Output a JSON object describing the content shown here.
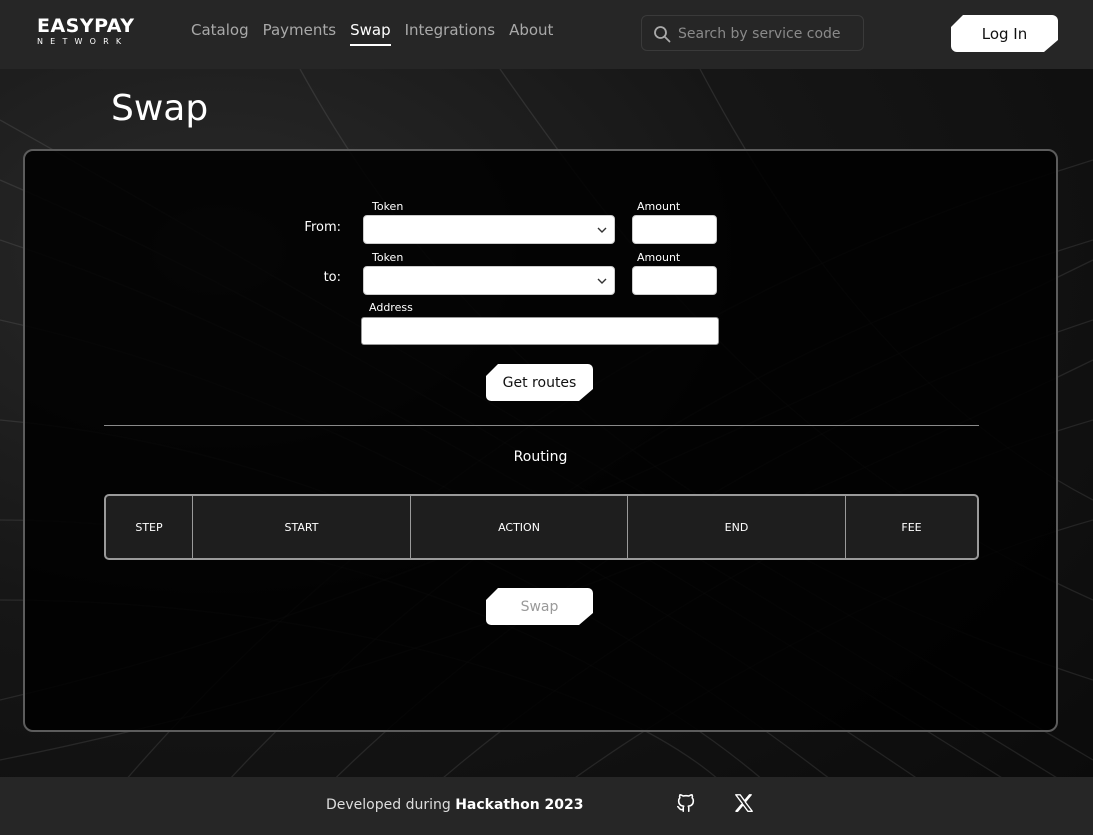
{
  "header": {
    "logo_main": "EASYPAY",
    "logo_sub": "NETWORK",
    "nav": [
      {
        "label": "Catalog"
      },
      {
        "label": "Payments"
      },
      {
        "label": "Swap"
      },
      {
        "label": "Integrations"
      },
      {
        "label": "About"
      }
    ],
    "active_nav": "Swap",
    "search_placeholder": "Search by service code",
    "search_icon": "search-icon",
    "login_label": "Log In"
  },
  "page": {
    "title": "Swap"
  },
  "swap_form": {
    "from_label": "From:",
    "to_label": "to:",
    "token_label": "Token",
    "amount_label": "Amount",
    "address_label": "Address",
    "from_token_value": "",
    "from_amount_value": "",
    "to_token_value": "",
    "to_amount_value": "",
    "address_value": "",
    "get_routes_label": "Get routes"
  },
  "routing": {
    "title": "Routing",
    "columns": [
      "STEP",
      "START",
      "ACTION",
      "END",
      "FEE"
    ],
    "rows": []
  },
  "swap_button_label": "Swap",
  "footer": {
    "text_prefix": "Developed during",
    "text_bold": "Hackathon 2023",
    "icons": [
      "github-icon",
      "x-twitter-icon"
    ]
  },
  "colors": {
    "header_bg": "#262626",
    "panel_bg": "#000000",
    "button_bg": "#ffffff",
    "accent": "#ffffff"
  }
}
